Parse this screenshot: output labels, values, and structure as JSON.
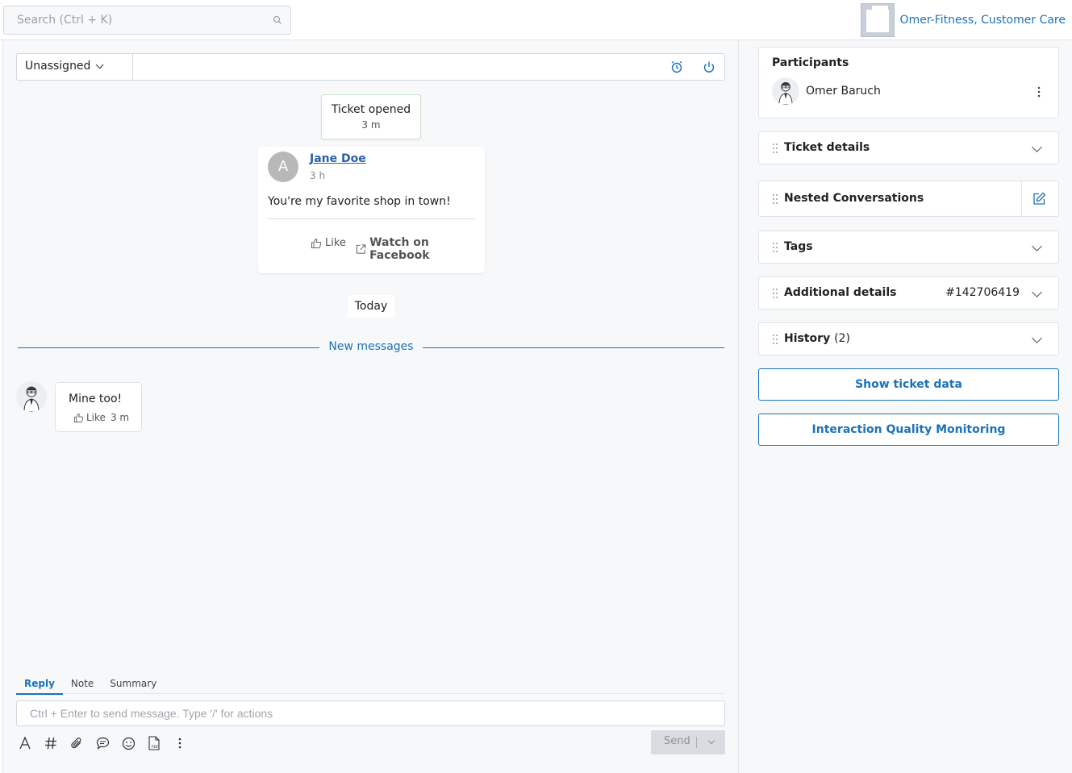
{
  "topbar": {
    "search_placeholder": "Search (Ctrl + K)",
    "account_name": "Omer-Fitness, Customer Care"
  },
  "toolbar": {
    "assignee": "Unassigned"
  },
  "timeline": {
    "ticket_opened": {
      "title": "Ticket opened",
      "time": "3 m"
    },
    "post": {
      "avatar_letter": "A",
      "author": "Jane Doe",
      "time": "3 h",
      "text": "You're my favorite shop in town!",
      "like_label": "Like",
      "facebook_label": "Watch on Facebook"
    },
    "day_separator": "Today",
    "new_messages_label": "New messages",
    "reply": {
      "text": "Mine too!",
      "like_label": "Like",
      "time": "3 m"
    }
  },
  "composer": {
    "tabs": [
      {
        "label": "Reply",
        "active": true
      },
      {
        "label": "Note",
        "active": false
      },
      {
        "label": "Summary",
        "active": false
      }
    ],
    "placeholder": "Ctrl + Enter to send message. Type '/' for actions",
    "send_label": "Send",
    "format_icons": [
      "text-format-icon",
      "hashtag-icon",
      "attachment-icon",
      "chat-bubble-icon",
      "emoji-icon",
      "pdf-icon",
      "more-vertical-icon"
    ]
  },
  "sidebar": {
    "participants": {
      "title": "Participants",
      "name": "Omer Baruch"
    },
    "sections": {
      "ticket_details": "Ticket details",
      "nested_conversations": "Nested Conversations",
      "tags": "Tags",
      "additional_details": "Additional details",
      "additional_details_id": "#142706419",
      "history": "History",
      "history_count": "(2)"
    },
    "buttons": {
      "show_ticket_data": "Show ticket data",
      "iqm": "Interaction Quality Monitoring"
    }
  },
  "colors": {
    "accent": "#1c72b8",
    "background": "#f6f8fa",
    "ticket_opened_border": "#cde5cf"
  }
}
